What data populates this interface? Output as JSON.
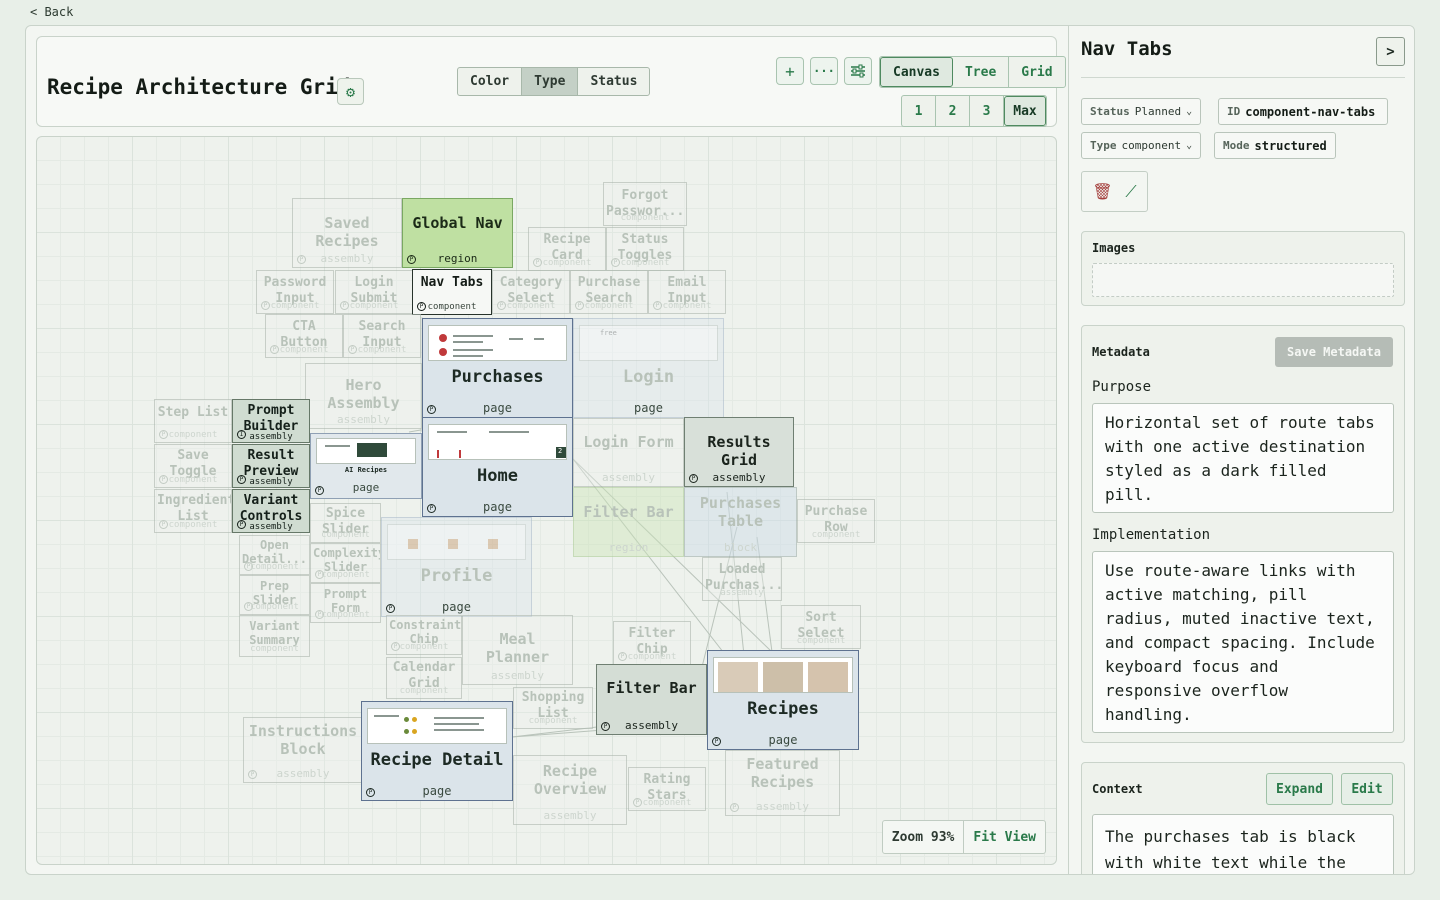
{
  "nav": {
    "back_label": "< Back"
  },
  "header": {
    "title": "Recipe Architecture Grid",
    "settings_icon": "gear-icon",
    "lens_options": [
      "Color",
      "Type",
      "Status"
    ],
    "lens_selected": "Type",
    "actions": {
      "add": "+",
      "more": "···",
      "filters": "sliders-icon"
    },
    "view_options": [
      "Canvas",
      "Tree",
      "Grid"
    ],
    "view_selected": "Canvas",
    "depth_options": [
      "1",
      "2",
      "3",
      "Max"
    ],
    "depth_selected": "Max"
  },
  "canvas": {
    "zoom_label": "Zoom 93%",
    "fit_view_label": "Fit View",
    "nodes": [
      {
        "title": "Saved Recipes",
        "type": "assembly"
      },
      {
        "title": "Global Nav",
        "type": "region"
      },
      {
        "title": "Forgot Passwor...",
        "type": "component"
      },
      {
        "title": "Recipe Card",
        "type": "component"
      },
      {
        "title": "Status Toggles",
        "type": "component"
      },
      {
        "title": "Password Input",
        "type": "component"
      },
      {
        "title": "Login Submit",
        "type": "component"
      },
      {
        "title": "Nav Tabs",
        "type": "component"
      },
      {
        "title": "Category Select",
        "type": "component"
      },
      {
        "title": "Purchase Search",
        "type": "component"
      },
      {
        "title": "Email Input",
        "type": "component"
      },
      {
        "title": "CTA Button",
        "type": "component"
      },
      {
        "title": "Search Input",
        "type": "component"
      },
      {
        "title": "Purchases",
        "type": "page"
      },
      {
        "title": "Login",
        "type": "page"
      },
      {
        "title": "Hero Assembly",
        "type": "assembly"
      },
      {
        "title": "Step List",
        "type": "component"
      },
      {
        "title": "Prompt Builder",
        "type": "assembly"
      },
      {
        "title": "Result Preview",
        "type": "assembly"
      },
      {
        "title": "Variant Controls",
        "type": "assembly"
      },
      {
        "title": "Save Toggle",
        "type": "component"
      },
      {
        "title": "Ingredient List",
        "type": "component"
      },
      {
        "title": "AI Recipes",
        "type": "page"
      },
      {
        "title": "Home",
        "type": "page"
      },
      {
        "title": "Login Form",
        "type": "assembly"
      },
      {
        "title": "Results Grid",
        "type": "assembly"
      },
      {
        "title": "Filter Bar",
        "type": "region"
      },
      {
        "title": "Purchases Table",
        "type": "block"
      },
      {
        "title": "Purchase Row",
        "type": "component"
      },
      {
        "title": "Spice Slider",
        "type": "component"
      },
      {
        "title": "Open Detail...",
        "type": "component"
      },
      {
        "title": "Complexity Slider",
        "type": "component"
      },
      {
        "title": "Profile",
        "type": "page"
      },
      {
        "title": "Loaded Purchas...",
        "type": "assembly"
      },
      {
        "title": "Prep Slider",
        "type": "component"
      },
      {
        "title": "Prompt Form",
        "type": "component"
      },
      {
        "title": "Constraint Chip",
        "type": "component"
      },
      {
        "title": "Meal Planner",
        "type": "assembly"
      },
      {
        "title": "Filter Chip",
        "type": "component"
      },
      {
        "title": "Sort Select",
        "type": "component"
      },
      {
        "title": "Variant Summary",
        "type": "component"
      },
      {
        "title": "Calendar Grid",
        "type": "component"
      },
      {
        "title": "Filter Bar",
        "type": "assembly"
      },
      {
        "title": "Recipes",
        "type": "page"
      },
      {
        "title": "Shopping List",
        "type": "component"
      },
      {
        "title": "Instructions Block",
        "type": "assembly"
      },
      {
        "title": "Recipe Detail",
        "type": "page"
      },
      {
        "title": "Recipe Overview",
        "type": "assembly"
      },
      {
        "title": "Rating Stars",
        "type": "component"
      },
      {
        "title": "Featured Recipes",
        "type": "assembly"
      }
    ],
    "thumb_texts": {
      "login_thumb": "free",
      "ai_recipes_thumb": "AI Recipes",
      "home_badge": "2"
    }
  },
  "panel": {
    "title": "Nav Tabs",
    "collapse_label": ">",
    "chips": {
      "status": {
        "key": "Status",
        "value": "Planned"
      },
      "id": {
        "key": "ID",
        "value": "component-nav-tabs"
      },
      "type": {
        "key": "Type",
        "value": "component"
      },
      "mode": {
        "key": "Mode",
        "value": "structured"
      }
    },
    "tools": {
      "delete": "trash-icon",
      "magic": "magic-wand-icon"
    },
    "images_label": "Images",
    "metadata": {
      "label": "Metadata",
      "save_label": "Save Metadata",
      "purpose_label": "Purpose",
      "purpose_value": "Horizontal set of route tabs with one active destination styled as a dark filled pill.",
      "implementation_label": "Implementation",
      "implementation_value": "Use route-aware links with active matching, pill radius, muted inactive text, and compact spacing. Include keyboard focus and responsive overflow handling."
    },
    "context": {
      "label": "Context",
      "expand_label": "Expand",
      "edit_label": "Edit",
      "value": "The purchases tab is black with white text while the"
    }
  },
  "colors": {
    "accent": "#2a7a4a",
    "page_fill": "#dbe4ea",
    "region_fill": "#bfe0a2",
    "assembly_fill": "#d4ddd5"
  }
}
